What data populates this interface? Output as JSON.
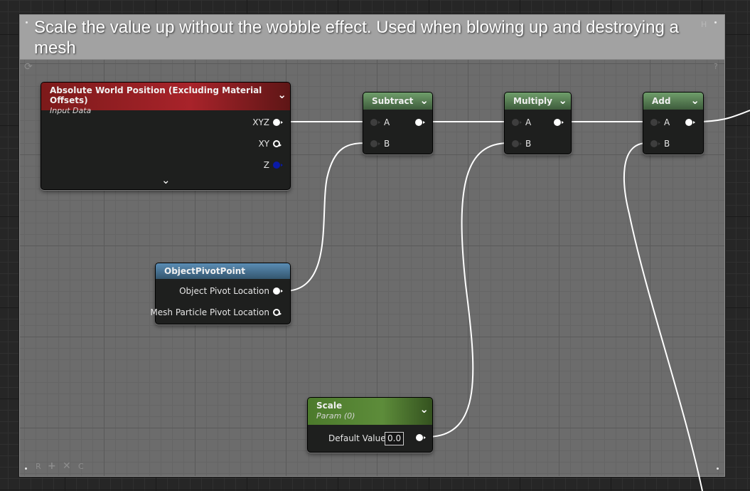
{
  "comment": {
    "text": "Scale the value up without the wobble effect.  Used when blowing up and destroying a mesh",
    "header_letter": "H",
    "footer_letters": [
      "R",
      "C"
    ]
  },
  "nodes": {
    "absolute_world_position": {
      "title": "Absolute World Position (Excluding Material Offsets)",
      "subtitle": "Input Data",
      "outputs": [
        "XYZ",
        "XY",
        "Z"
      ]
    },
    "subtract": {
      "title": "Subtract",
      "inputs": [
        "A",
        "B"
      ]
    },
    "multiply": {
      "title": "Multiply",
      "inputs": [
        "A",
        "B"
      ]
    },
    "add": {
      "title": "Add",
      "inputs": [
        "A",
        "B"
      ]
    },
    "object_pivot_point": {
      "title": "ObjectPivotPoint",
      "outputs": [
        "Object Pivot Location",
        "Mesh Particle Pivot Location"
      ]
    },
    "scale": {
      "title": "Scale",
      "subtitle": "Param (0)",
      "default_label": "Default Value",
      "default_value": "0.0"
    }
  },
  "colors": {
    "input_data_header": "#8f1c1c",
    "math_header": "#5e8c5a",
    "pivot_header": "#4f7ea3",
    "param_header": "#4f7a2e",
    "wire": "#ffffff"
  },
  "icons": [
    "refresh-icon",
    "question-icon",
    "chevron-down-icon",
    "plus-icon",
    "close-icon"
  ]
}
